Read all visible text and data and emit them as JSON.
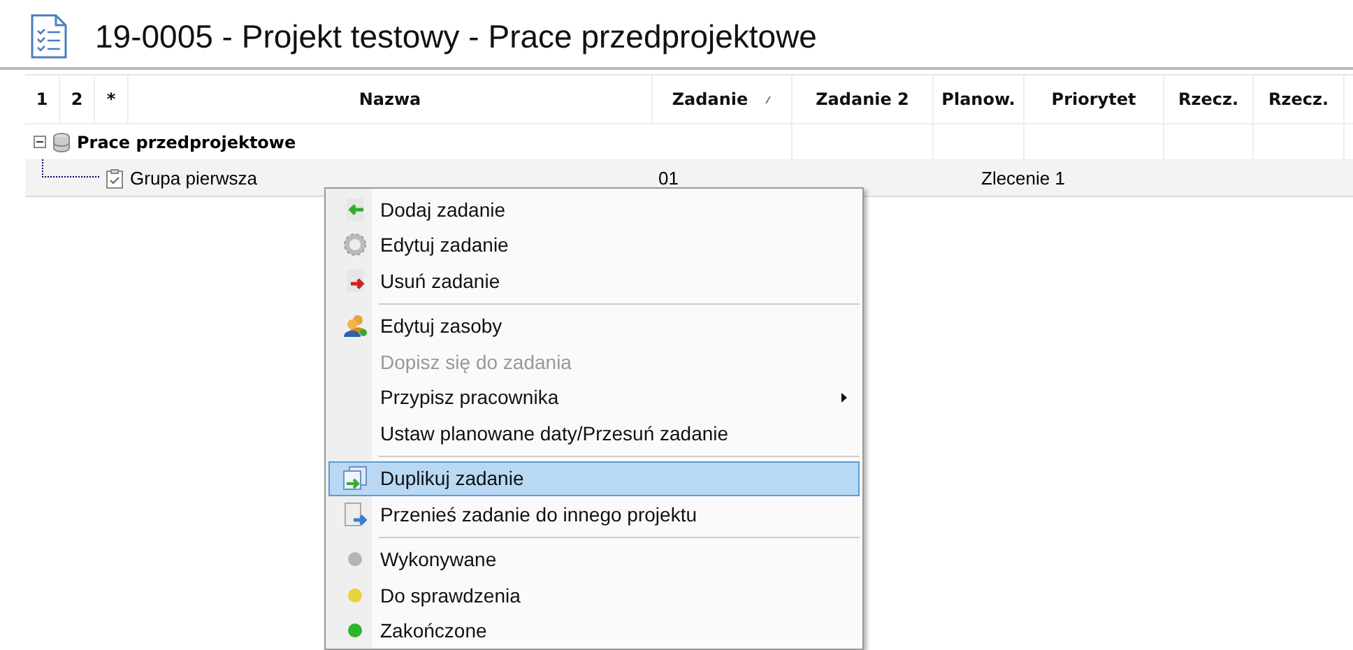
{
  "title": "19-0005 - Projekt testowy - Prace przedprojektowe",
  "table": {
    "columns": [
      {
        "label": "1"
      },
      {
        "label": "2"
      },
      {
        "label": "*"
      },
      {
        "label": "Nazwa"
      },
      {
        "label": "Zadanie",
        "sorted": true
      },
      {
        "label": "Zadanie 2"
      },
      {
        "label": "Planow."
      },
      {
        "label": "Priorytet"
      },
      {
        "label": "Rzecz."
      },
      {
        "label": "Rzecz."
      }
    ],
    "tree": [
      {
        "name": "Prace przedprojektowe",
        "expanded": true,
        "children": [
          {
            "name": "Grupa pierwsza",
            "zadanie": "01",
            "span_text": "Zlecenie 1"
          }
        ]
      }
    ]
  },
  "context_menu": {
    "items": [
      {
        "kind": "item",
        "label": "Dodaj zadanie",
        "disabled": false,
        "submenu": false,
        "selected": false
      },
      {
        "kind": "item",
        "label": "Edytuj zadanie",
        "disabled": false,
        "submenu": false,
        "selected": false
      },
      {
        "kind": "item",
        "label": "Usuń zadanie",
        "disabled": false,
        "submenu": false,
        "selected": false
      },
      {
        "kind": "separator"
      },
      {
        "kind": "item",
        "label": "Edytuj zasoby",
        "disabled": false,
        "submenu": false,
        "selected": false
      },
      {
        "kind": "item",
        "label": "Dopisz się do zadania",
        "disabled": true,
        "submenu": false,
        "selected": false
      },
      {
        "kind": "item",
        "label": "Przypisz pracownika",
        "disabled": false,
        "submenu": true,
        "selected": false
      },
      {
        "kind": "item",
        "label": "Ustaw planowane daty/Przesuń zadanie",
        "disabled": false,
        "submenu": false,
        "selected": false
      },
      {
        "kind": "separator"
      },
      {
        "kind": "item",
        "label": "Duplikuj zadanie",
        "disabled": false,
        "submenu": false,
        "selected": true
      },
      {
        "kind": "item",
        "label": "Przenieś zadanie do innego projektu",
        "disabled": false,
        "submenu": false,
        "selected": false
      },
      {
        "kind": "separator"
      },
      {
        "kind": "item",
        "label": "Wykonywane",
        "color": "#b4b4b4",
        "disabled": false,
        "submenu": false,
        "selected": false
      },
      {
        "kind": "item",
        "label": "Do sprawdzenia",
        "color": "#e6d43a",
        "disabled": false,
        "submenu": false,
        "selected": false
      },
      {
        "kind": "item",
        "label": "Zakończone",
        "color": "#2cb52c",
        "disabled": false,
        "submenu": false,
        "selected": false
      }
    ]
  }
}
